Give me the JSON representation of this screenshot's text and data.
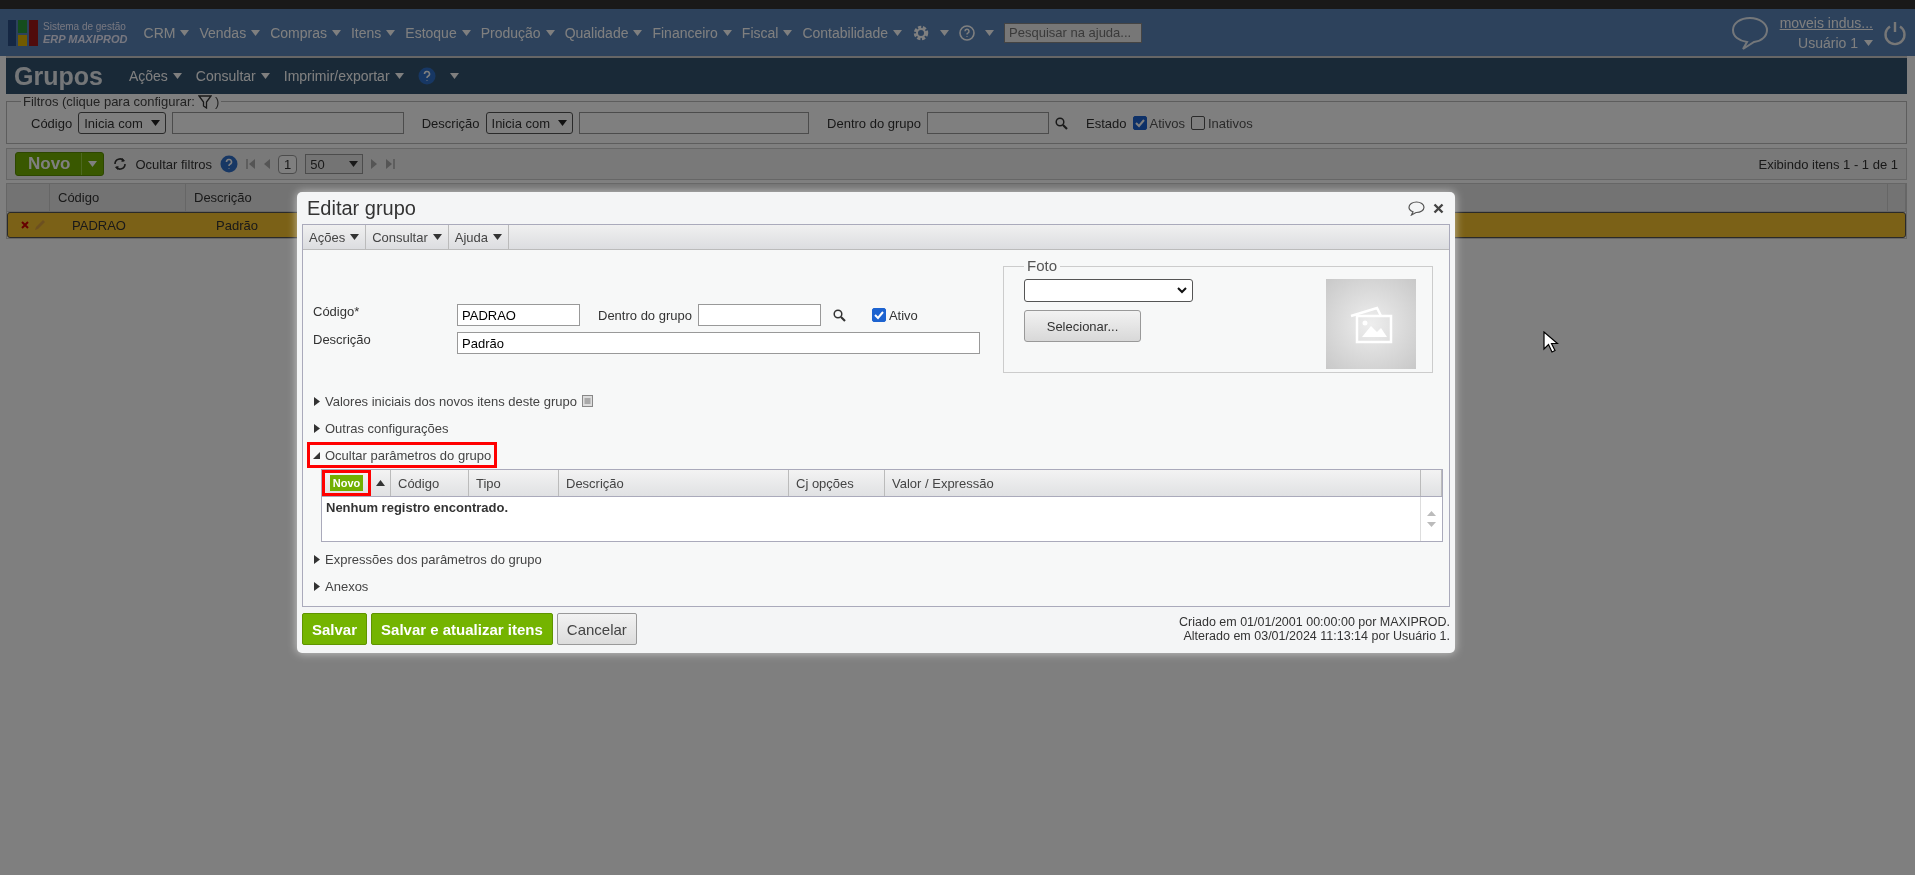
{
  "top_bar": {
    "logo_line_1": "Sistema de gestão",
    "logo_line_2": "ERP MAXIPROD",
    "menus": [
      "CRM",
      "Vendas",
      "Compras",
      "Itens",
      "Estoque",
      "Produção",
      "Qualidade",
      "Financeiro",
      "Fiscal",
      "Contabilidade"
    ],
    "help_search": {
      "placeholder": "Pesquisar na ajuda..."
    },
    "company_link": "moveis indus...",
    "user": "Usuário 1"
  },
  "page": {
    "title": "Grupos",
    "menus": [
      "Ações",
      "Consultar",
      "Imprimir/exportar"
    ]
  },
  "filters": {
    "legend": "Filtros (clique para configurar:",
    "legend_end": ")",
    "code": {
      "label": "Código",
      "operator": "Inicia com"
    },
    "description": {
      "label": "Descrição",
      "operator": "Inicia com"
    },
    "parent": {
      "label": "Dentro do grupo"
    },
    "state": {
      "label": "Estado",
      "options": [
        {
          "label": "Ativos",
          "checked": true
        },
        {
          "label": "Inativos",
          "checked": false
        }
      ]
    }
  },
  "toolbar": {
    "new_button": "Novo",
    "hide_filters": "Ocultar filtros",
    "page": "1",
    "page_size": "50",
    "summary": "Exibindo itens 1 - 1 de 1"
  },
  "table": {
    "columns": [
      "Código",
      "Descrição"
    ],
    "rows": [
      {
        "cells": [
          "PADRAO",
          "Padrão"
        ],
        "selected": true
      }
    ]
  },
  "dialog": {
    "title": "Editar grupo",
    "menus": [
      "Ações",
      "Consultar",
      "Ajuda"
    ],
    "fields": {
      "code": {
        "label": "Código*",
        "value": "PADRAO"
      },
      "parent": {
        "label": "Dentro do grupo"
      },
      "active": {
        "label": "Ativo",
        "checked": true
      },
      "description": {
        "label": "Descrição",
        "value": "Padrão"
      }
    },
    "photo": {
      "legend": "Foto",
      "button": "Selecionar..."
    },
    "sections_before": [
      {
        "label": "Valores iniciais dos novos itens deste grupo",
        "expanded": false,
        "highlighted": false,
        "note_icon": true
      },
      {
        "label": "Outras configurações",
        "expanded": false,
        "highlighted": false,
        "note_icon": false
      },
      {
        "label": "Ocultar parâmetros do grupo",
        "expanded": true,
        "highlighted": true,
        "note_icon": false
      }
    ],
    "parameters_grid": {
      "new_button": {
        "label": "Novo",
        "highlighted": true
      },
      "columns": [
        "Código",
        "Tipo",
        "Descrição",
        "Cj opções",
        "Valor / Expressão"
      ],
      "empty_message": "Nenhum registro encontrado."
    },
    "sections_after": [
      {
        "label": "Expressões dos parâmetros do grupo",
        "expanded": false,
        "highlighted": false,
        "note_icon": false
      },
      {
        "label": "Anexos",
        "expanded": false,
        "highlighted": false,
        "note_icon": false
      }
    ],
    "buttons": [
      {
        "label": "Salvar",
        "kind": "primary"
      },
      {
        "label": "Salvar e atualizar itens",
        "kind": "primary"
      },
      {
        "label": "Cancelar",
        "kind": "secondary"
      }
    ],
    "audit": [
      "Criado em 01/01/2001 00:00:00 por MAXIPROD.",
      "Alterado em 03/01/2024 11:13:14 por Usuário 1."
    ]
  }
}
